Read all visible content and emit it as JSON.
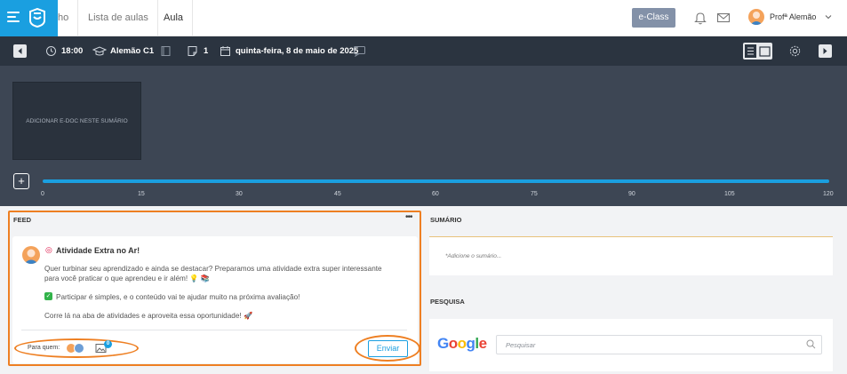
{
  "nav": {
    "tab_truncated": "ho",
    "tab_lessons": "Lista de aulas",
    "tab_class": "Aula"
  },
  "header": {
    "eclass_label": "e-Class",
    "user_name": "Profª Alemão"
  },
  "toolbar": {
    "time": "18:00",
    "group": "Alemão C1",
    "count": "1",
    "date": "quinta-feira, 8 de maio de 2025"
  },
  "timeline": {
    "edoc_placeholder": "ADICIONAR E-DOC NESTE SUMÁRIO",
    "ticks": [
      "0",
      "15",
      "30",
      "45",
      "60",
      "75",
      "90",
      "105",
      "120"
    ]
  },
  "feed": {
    "title": "FEED",
    "post_title": "Atividade Extra no Ar!",
    "lines": [
      "Quer turbinar seu aprendizado e ainda se destacar? Preparamos uma atividade extra super interessante",
      "para você praticar o que aprendeu e ir além! 💡 📚",
      "Participar é simples, e o conteúdo vai te ajudar muito na próxima avaliação!",
      "Corre lá na aba de atividades e aproveita essa oportunidade! 🚀"
    ],
    "to_label": "Para quem:",
    "badge_count": "0",
    "send_label": "Enviar"
  },
  "summary": {
    "title": "SUMÁRIO",
    "placeholder": "*Adicione o sumário..."
  },
  "search": {
    "title": "PESQUISA",
    "brand": "Google",
    "placeholder": "Pesquisar"
  },
  "colors": {
    "brand_blue": "#1a9fe0",
    "toolbar_dark": "#2b3440",
    "timeline_bg": "#3d4654",
    "highlight_orange": "#ee7f22"
  }
}
